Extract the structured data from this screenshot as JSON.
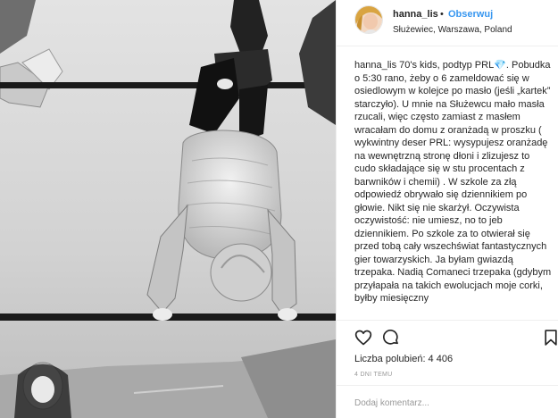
{
  "post": {
    "username": "hanna_lis",
    "separator": "•",
    "follow_label": "Obserwuj",
    "location": "Służewiec, Warszawa, Poland",
    "caption_user": "hanna_lis",
    "caption_text": "70's kids, podtyp PRL💎. Pobudka o 5:30 rano, żeby o 6 zameldować się w osiedlowym w kolejce po masło (jeśli „kartek” starczyło). U mnie na Służewcu mało masła rzucali, więc często zamiast z masłem wracałam do domu z oranżadą w proszku ( wykwintny deser PRL: wysypujesz oranżadę na wewnętrzną stronę dłoni i zlizujesz to cudo składające się w stu procentach z barwników i chemii) . W szkole za złą odpowiedź obrywało się dziennikiem po głowie. Nikt się nie skarżył. Oczywista oczywistość: nie umiesz, no to jeb dziennikiem. Po szkole za to otwierał się przed tobą cały wszechświat fantastycznych gier towarzyskich. Ja byłam gwiazdą trzepaka. Nadią Comaneci trzepaka (gdybym przyłapała na takich ewolucjach moje corki, byłby miesięczny",
    "likes_text": "Liczba polubień: 4 406",
    "timestamp": "4 DNI TEMU",
    "comment_placeholder": "Dodaj komentarz..."
  },
  "icons": {
    "like": "heart-outline-icon",
    "comment": "speech-bubble-icon",
    "save": "bookmark-icon"
  },
  "colors": {
    "accent": "#3897f0",
    "text": "#262626",
    "muted": "#999999",
    "border": "#efefef"
  }
}
